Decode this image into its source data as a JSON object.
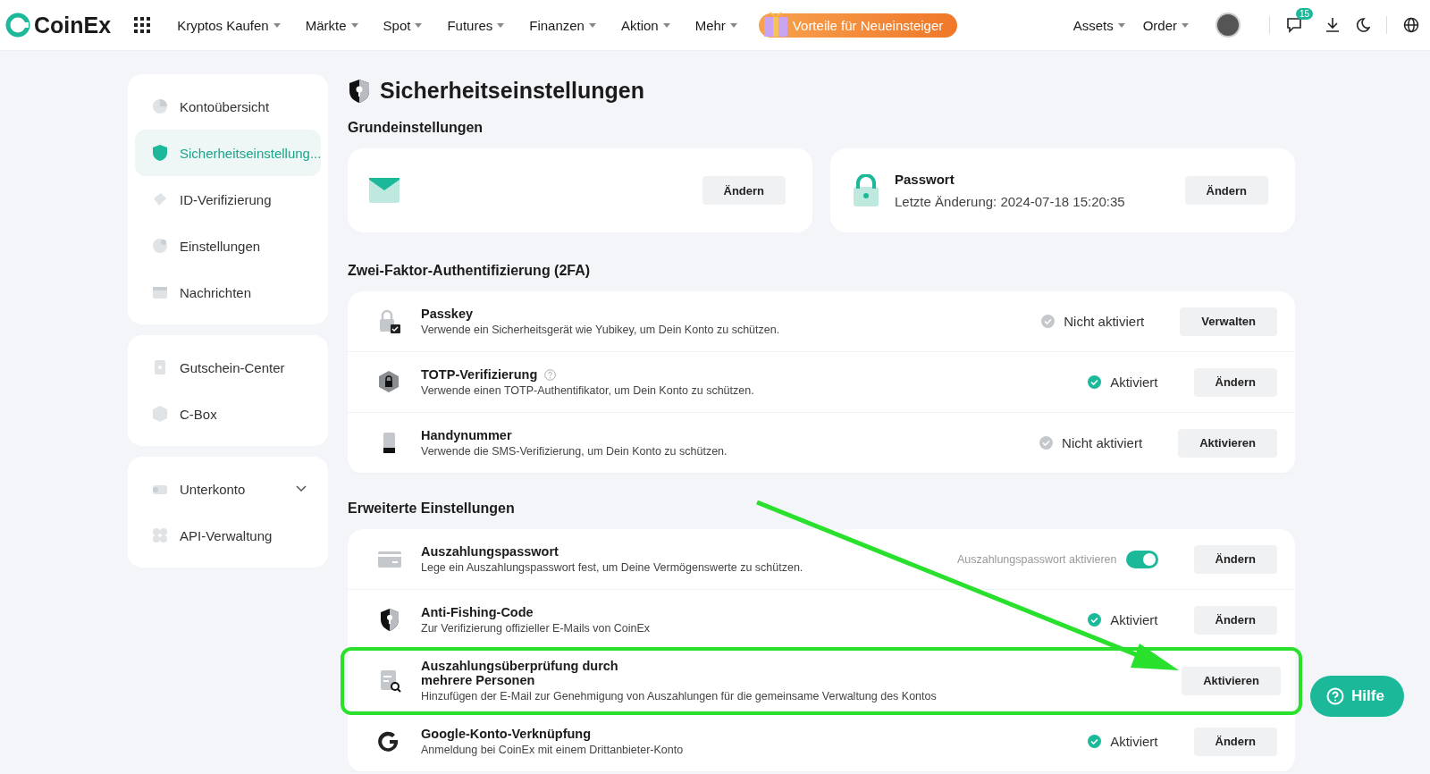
{
  "header": {
    "logo": "CoinEx",
    "nav": [
      "Kryptos Kaufen",
      "Märkte",
      "Spot",
      "Futures",
      "Finanzen",
      "Aktion",
      "Mehr"
    ],
    "promo": "Vorteile für Neueinsteiger",
    "right_menus": [
      "Assets",
      "Order"
    ],
    "message_badge": "15"
  },
  "sidebar": {
    "groups": [
      {
        "items": [
          {
            "label": "Kontoübersicht",
            "selected": false
          },
          {
            "label": "Sicherheitseinstellung...",
            "selected": true
          },
          {
            "label": "ID-Verifizierung",
            "selected": false
          },
          {
            "label": "Einstellungen",
            "selected": false
          },
          {
            "label": "Nachrichten",
            "selected": false
          }
        ]
      },
      {
        "items": [
          {
            "label": "Gutschein-Center",
            "selected": false
          },
          {
            "label": "C-Box",
            "selected": false
          }
        ]
      },
      {
        "items": [
          {
            "label": "Unterkonto",
            "selected": false,
            "expanded": false
          },
          {
            "label": "API-Verwaltung",
            "selected": false
          }
        ]
      }
    ]
  },
  "page": {
    "title": "Sicherheitseinstellungen",
    "basic": {
      "heading": "Grundeinstellungen",
      "cards": [
        {
          "button": "Ändern"
        },
        {
          "title": "Passwort",
          "subtitle": "Letzte Änderung: 2024-07-18 15:20:35",
          "button": "Ändern"
        }
      ]
    },
    "sections": [
      {
        "heading": "Zwei-Faktor-Authentifizierung (2FA)",
        "rows": [
          {
            "title": "Passkey",
            "help": false,
            "description": "Verwende ein Sicherheitsgerät wie Yubikey, um Dein Konto zu schützen.",
            "kind": "status",
            "status": "Nicht aktiviert",
            "active": false,
            "button": "Verwalten",
            "highlighted": false
          },
          {
            "title": "TOTP-Verifizierung",
            "help": true,
            "description": "Verwende einen TOTP-Authentifikator, um Dein Konto zu schützen.",
            "kind": "status",
            "status": "Aktiviert",
            "active": true,
            "button": "Ändern",
            "highlighted": false
          },
          {
            "title": "Handynummer",
            "help": false,
            "description": "Verwende die SMS-Verifizierung, um Dein Konto zu schützen.",
            "kind": "status",
            "status": "Nicht aktiviert",
            "active": false,
            "button": "Aktivieren",
            "highlighted": false
          }
        ]
      },
      {
        "heading": "Erweiterte Einstellungen",
        "rows": [
          {
            "title": "Auszahlungspasswort",
            "help": false,
            "description": "Lege ein Auszahlungspasswort fest, um Deine Vermögenswerte zu schützen.",
            "kind": "toggle",
            "status": "Auszahlungspasswort aktivieren",
            "on": true,
            "button": "Ändern",
            "highlighted": false
          },
          {
            "title": "Anti-Fishing-Code",
            "help": false,
            "description": "Zur Verifizierung offizieller E-Mails von CoinEx",
            "kind": "status",
            "status": "Aktiviert",
            "active": true,
            "button": "Ändern",
            "highlighted": false
          },
          {
            "title": "Auszahlungsüberprüfung durch mehrere Personen",
            "help": false,
            "description": "Hinzufügen der E-Mail zur Genehmigung von Auszahlungen für die gemeinsame Verwaltung des Kontos",
            "kind": "none",
            "button": "Aktivieren",
            "highlighted": true
          },
          {
            "title": "Google-Konto-Verknüpfung",
            "help": false,
            "description": "Anmeldung bei CoinEx mit einem Drittanbieter-Konto",
            "kind": "status",
            "status": "Aktiviert",
            "active": true,
            "button": "Ändern",
            "highlighted": false
          }
        ]
      }
    ]
  },
  "annotation_arrow": true,
  "help_button": "Hilfe"
}
